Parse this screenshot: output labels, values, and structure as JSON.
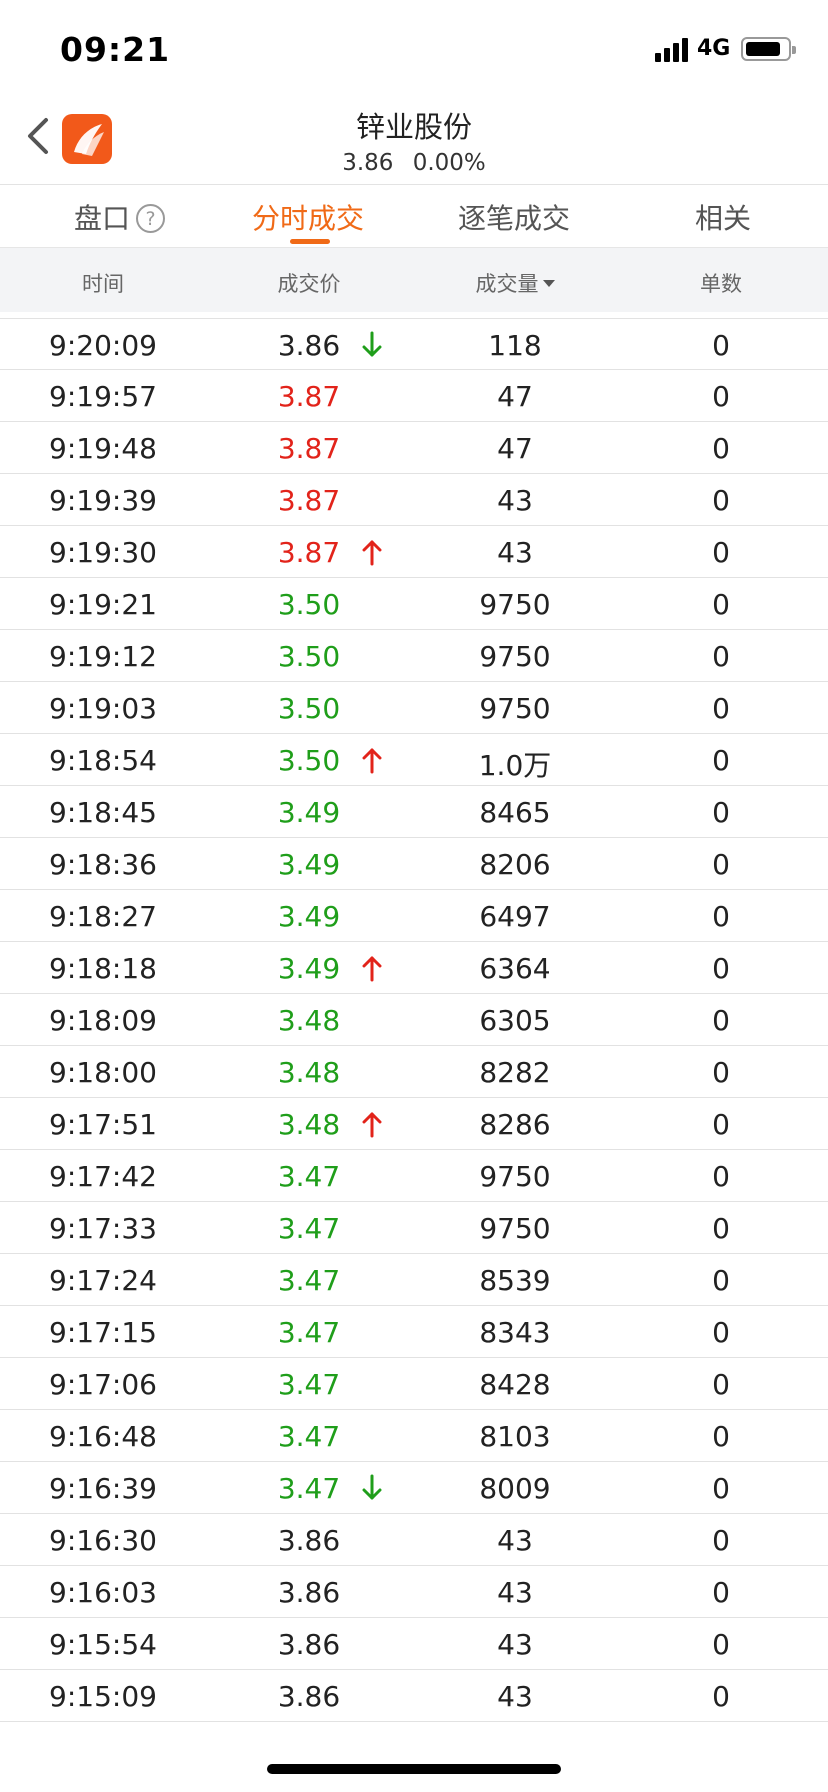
{
  "status_bar": {
    "time": "09:21",
    "network": "4G"
  },
  "header": {
    "title": "锌业股份",
    "price": "3.86",
    "change_pct": "0.00%"
  },
  "tabs": [
    {
      "label": "盘口",
      "active": false
    },
    {
      "label": "分时成交",
      "active": true
    },
    {
      "label": "逐笔成交",
      "active": false
    },
    {
      "label": "相关",
      "active": false
    }
  ],
  "help_icon_text": "?",
  "columns": {
    "time": "时间",
    "price": "成交价",
    "volume": "成交量",
    "count": "单数"
  },
  "colors": {
    "up": "#e2231a",
    "down": "#1f9e1a",
    "accent": "#f06a17",
    "neutral": "#222222"
  },
  "trades": [
    {
      "time": "9:20:09",
      "price": "3.86",
      "price_color": "black",
      "arrow": "down",
      "volume": "118",
      "count": "0"
    },
    {
      "time": "9:19:57",
      "price": "3.87",
      "price_color": "red",
      "arrow": "",
      "volume": "47",
      "count": "0"
    },
    {
      "time": "9:19:48",
      "price": "3.87",
      "price_color": "red",
      "arrow": "",
      "volume": "47",
      "count": "0"
    },
    {
      "time": "9:19:39",
      "price": "3.87",
      "price_color": "red",
      "arrow": "",
      "volume": "43",
      "count": "0"
    },
    {
      "time": "9:19:30",
      "price": "3.87",
      "price_color": "red",
      "arrow": "up",
      "volume": "43",
      "count": "0"
    },
    {
      "time": "9:19:21",
      "price": "3.50",
      "price_color": "green",
      "arrow": "",
      "volume": "9750",
      "count": "0"
    },
    {
      "time": "9:19:12",
      "price": "3.50",
      "price_color": "green",
      "arrow": "",
      "volume": "9750",
      "count": "0"
    },
    {
      "time": "9:19:03",
      "price": "3.50",
      "price_color": "green",
      "arrow": "",
      "volume": "9750",
      "count": "0"
    },
    {
      "time": "9:18:54",
      "price": "3.50",
      "price_color": "green",
      "arrow": "up",
      "volume": "1.0万",
      "count": "0"
    },
    {
      "time": "9:18:45",
      "price": "3.49",
      "price_color": "green",
      "arrow": "",
      "volume": "8465",
      "count": "0"
    },
    {
      "time": "9:18:36",
      "price": "3.49",
      "price_color": "green",
      "arrow": "",
      "volume": "8206",
      "count": "0"
    },
    {
      "time": "9:18:27",
      "price": "3.49",
      "price_color": "green",
      "arrow": "",
      "volume": "6497",
      "count": "0"
    },
    {
      "time": "9:18:18",
      "price": "3.49",
      "price_color": "green",
      "arrow": "up",
      "volume": "6364",
      "count": "0"
    },
    {
      "time": "9:18:09",
      "price": "3.48",
      "price_color": "green",
      "arrow": "",
      "volume": "6305",
      "count": "0"
    },
    {
      "time": "9:18:00",
      "price": "3.48",
      "price_color": "green",
      "arrow": "",
      "volume": "8282",
      "count": "0"
    },
    {
      "time": "9:17:51",
      "price": "3.48",
      "price_color": "green",
      "arrow": "up",
      "volume": "8286",
      "count": "0"
    },
    {
      "time": "9:17:42",
      "price": "3.47",
      "price_color": "green",
      "arrow": "",
      "volume": "9750",
      "count": "0"
    },
    {
      "time": "9:17:33",
      "price": "3.47",
      "price_color": "green",
      "arrow": "",
      "volume": "9750",
      "count": "0"
    },
    {
      "time": "9:17:24",
      "price": "3.47",
      "price_color": "green",
      "arrow": "",
      "volume": "8539",
      "count": "0"
    },
    {
      "time": "9:17:15",
      "price": "3.47",
      "price_color": "green",
      "arrow": "",
      "volume": "8343",
      "count": "0"
    },
    {
      "time": "9:17:06",
      "price": "3.47",
      "price_color": "green",
      "arrow": "",
      "volume": "8428",
      "count": "0"
    },
    {
      "time": "9:16:48",
      "price": "3.47",
      "price_color": "green",
      "arrow": "",
      "volume": "8103",
      "count": "0"
    },
    {
      "time": "9:16:39",
      "price": "3.47",
      "price_color": "green",
      "arrow": "down",
      "volume": "8009",
      "count": "0"
    },
    {
      "time": "9:16:30",
      "price": "3.86",
      "price_color": "black",
      "arrow": "",
      "volume": "43",
      "count": "0"
    },
    {
      "time": "9:16:03",
      "price": "3.86",
      "price_color": "black",
      "arrow": "",
      "volume": "43",
      "count": "0"
    },
    {
      "time": "9:15:54",
      "price": "3.86",
      "price_color": "black",
      "arrow": "",
      "volume": "43",
      "count": "0"
    },
    {
      "time": "9:15:09",
      "price": "3.86",
      "price_color": "black",
      "arrow": "",
      "volume": "43",
      "count": "0"
    }
  ]
}
